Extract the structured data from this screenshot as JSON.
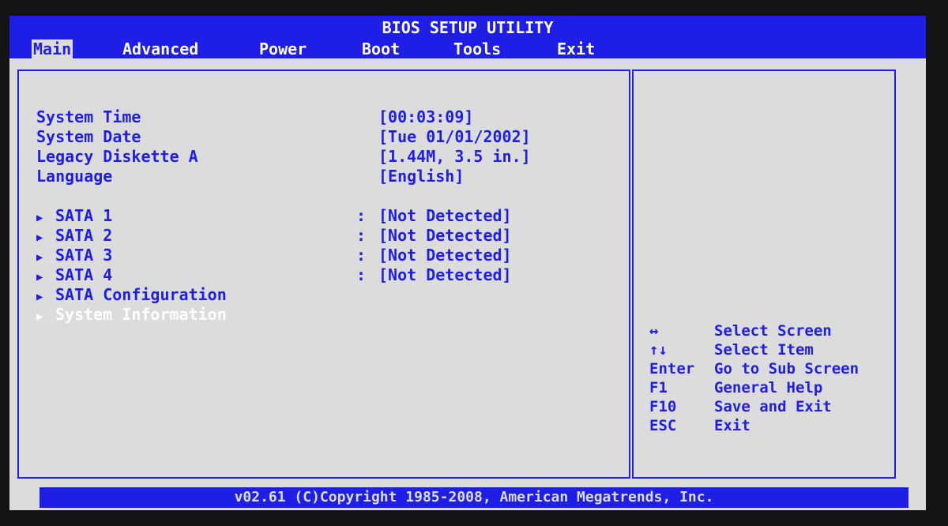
{
  "title": "BIOS SETUP UTILITY",
  "menu": [
    {
      "label": "Main",
      "active": true
    },
    {
      "label": "Advanced"
    },
    {
      "label": "Power"
    },
    {
      "label": "Boot"
    },
    {
      "label": "Tools"
    },
    {
      "label": "Exit"
    }
  ],
  "settings": [
    {
      "label": "System Time",
      "value": "[00:03:09]"
    },
    {
      "label": "System Date",
      "value": "[Tue 01/01/2002]"
    },
    {
      "label": "Legacy Diskette A",
      "value": "[1.44M, 3.5 in.]"
    },
    {
      "label": "Language",
      "value": "[English]"
    }
  ],
  "submenus": [
    {
      "label": "SATA 1",
      "separator": ":",
      "value": "[Not Detected]"
    },
    {
      "label": "SATA 2",
      "separator": ":",
      "value": "[Not Detected]"
    },
    {
      "label": "SATA 3",
      "separator": ":",
      "value": "[Not Detected]"
    },
    {
      "label": "SATA 4",
      "separator": ":",
      "value": "[Not Detected]"
    },
    {
      "label": "SATA Configuration"
    },
    {
      "label": "System Information",
      "selected": true
    }
  ],
  "submenu_arrow_icon": "right-triangle-icon",
  "help": [
    {
      "key": "↔",
      "action": "Select Screen"
    },
    {
      "key": "↑↓",
      "action": "Select Item"
    },
    {
      "key": "Enter",
      "action": "Go to Sub Screen"
    },
    {
      "key": "F1",
      "action": "General Help"
    },
    {
      "key": "F10",
      "action": "Save and Exit"
    },
    {
      "key": "ESC",
      "action": "Exit"
    }
  ],
  "footer": "v02.61 (C)Copyright 1985-2008, American Megatrends, Inc.",
  "colors": {
    "accent": "#1e1ee6",
    "background": "#dcdcdc",
    "highlight": "#ffffff"
  }
}
